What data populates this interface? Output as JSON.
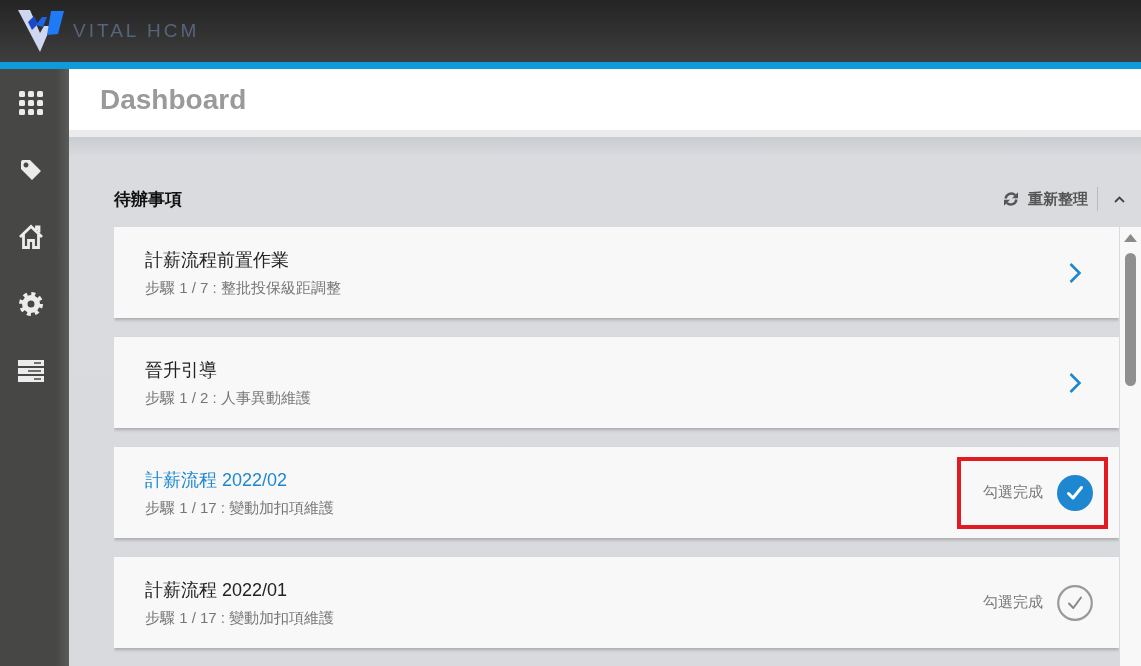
{
  "app": {
    "brand": "VITAL HCM"
  },
  "page": {
    "title": "Dashboard"
  },
  "todo": {
    "title": "待辦事項",
    "refresh_label": "重新整理",
    "expanded": true,
    "items": [
      {
        "kind": "step",
        "title": "計薪流程前置作業",
        "subtitle": "步驟 1 / 7 : 整批投保級距調整",
        "selected": false,
        "highlighted": false
      },
      {
        "kind": "step",
        "title": "晉升引導",
        "subtitle": "步驟 1 / 2 : 人事異動維護",
        "selected": false,
        "highlighted": false
      },
      {
        "kind": "check",
        "title": "計薪流程 2022/02",
        "subtitle": "步驟 1 / 17 : 變動加扣項維護",
        "action_label": "勾選完成",
        "checked": true,
        "selected": true,
        "highlighted": true
      },
      {
        "kind": "check",
        "title": "計薪流程 2022/01",
        "subtitle": "步驟 1 / 17 : 變動加扣項維護",
        "action_label": "勾選完成",
        "checked": false,
        "selected": false,
        "highlighted": false
      }
    ]
  }
}
